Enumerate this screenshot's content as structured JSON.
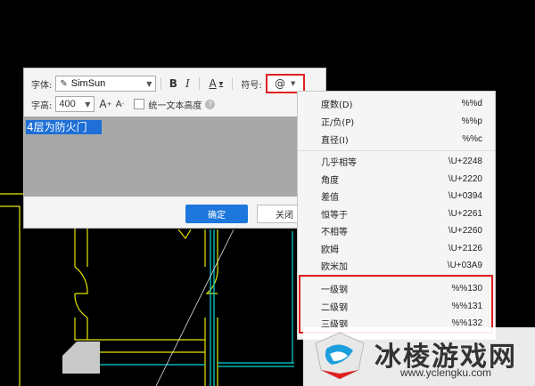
{
  "dialog": {
    "font_label": "字体:",
    "font_value": "SimSun",
    "bold_label": "B",
    "italic_label": "I",
    "color_label": "A",
    "symbol_label": "符号:",
    "symbol_button": "@",
    "height_label": "字高:",
    "height_value": "400",
    "increase_label": "A",
    "decrease_label": "A",
    "uniform_label": "统一文本高度",
    "text_content": "4层为防火门",
    "ok_button": "确定",
    "close_button": "关闭"
  },
  "symbol_menu": {
    "items": [
      {
        "name": "度数(D)",
        "code": "%%d"
      },
      {
        "name": "正/负(P)",
        "code": "%%p"
      },
      {
        "name": "直径(I)",
        "code": "%%c"
      },
      {
        "name": "几乎相等",
        "code": "\\U+2248"
      },
      {
        "name": "角度",
        "code": "\\U+2220"
      },
      {
        "name": "差值",
        "code": "\\U+0394"
      },
      {
        "name": "恒等于",
        "code": "\\U+2261"
      },
      {
        "name": "不相等",
        "code": "\\U+2260"
      },
      {
        "name": "欧姆",
        "code": "\\U+2126"
      },
      {
        "name": "欧米加",
        "code": "\\U+03A9"
      },
      {
        "name": "一级钢",
        "code": "%%130"
      },
      {
        "name": "二级钢",
        "code": "%%131"
      },
      {
        "name": "三级钢",
        "code": "%%132"
      }
    ]
  },
  "watermark": {
    "title": "冰棱游戏网",
    "url": "www.yclengku.com"
  },
  "colors": {
    "accent_blue": "#1d77dd",
    "highlight_red": "#e02020",
    "cad_yellow": "#e8e800",
    "cad_cyan": "#00d8d8",
    "selection_blue": "#1e6fd6"
  }
}
